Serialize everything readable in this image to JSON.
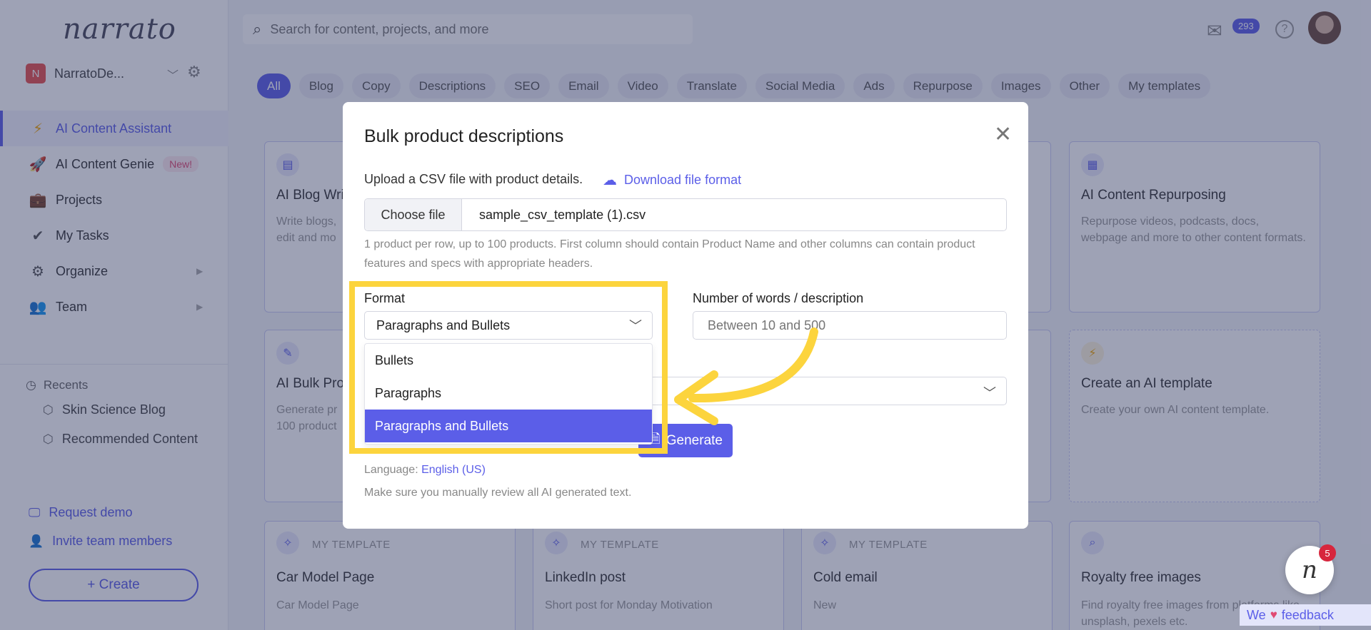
{
  "app": {
    "logo": "narrato"
  },
  "org": {
    "badge": "N",
    "name": "NarratoDe..."
  },
  "nav": {
    "items": [
      {
        "label": "AI Content Assistant",
        "icon": "⚡"
      },
      {
        "label": "AI Content Genie",
        "icon": "🚀",
        "badge": "New!"
      },
      {
        "label": "Projects",
        "icon": "💼"
      },
      {
        "label": "My Tasks",
        "icon": "✔"
      },
      {
        "label": "Organize",
        "icon": "⚙"
      },
      {
        "label": "Team",
        "icon": "👥"
      }
    ]
  },
  "recents": {
    "title": "Recents",
    "items": [
      "Skin Science Blog",
      "Recommended Content"
    ]
  },
  "bottom_links": {
    "request_demo": "Request demo",
    "invite": "Invite team members"
  },
  "create_button": "+ Create",
  "header": {
    "search_placeholder": "Search for content, projects, and more",
    "mail_count": "293",
    "help": "?"
  },
  "filters": [
    "All",
    "Blog",
    "Copy",
    "Descriptions",
    "SEO",
    "Email",
    "Video",
    "Translate",
    "Social Media",
    "Ads",
    "Repurpose",
    "Images",
    "Other",
    "My templates"
  ],
  "cards": {
    "blog_title": "AI Blog Writ",
    "blog_desc": "Write blogs, edit and mo",
    "repurpose_title": "AI Content Repurposing",
    "repurpose_desc": "Repurpose videos, podcasts, docs, webpage and more to other content formats.",
    "bulk_title": "AI Bulk Pro",
    "bulk_desc": "Generate pr 100 product",
    "template_title": "Create an AI template",
    "template_desc": "Create your own AI content template.",
    "tpl_tag": "MY TEMPLATE",
    "car_title": "Car Model Page",
    "car_desc": "Car Model Page",
    "linkedin_title": "LinkedIn post",
    "linkedin_desc": "Short post for Monday Motivation",
    "cold_title": "Cold email",
    "cold_desc": "New",
    "royalty_title": "Royalty free images",
    "royalty_desc": "Find royalty free images from platforms like unsplash, pexels etc."
  },
  "modal": {
    "title": "Bulk product descriptions",
    "upload_label": "Upload a CSV file with product details.",
    "download_link": "Download file format",
    "choose_file": "Choose file",
    "file_name": "sample_csv_template (1).csv",
    "help_text": "1 product per row, up to 100 products. First column should contain Product Name and other columns can contain product features and specs with appropriate headers.",
    "format_label": "Format",
    "format_value": "Paragraphs and Bullets",
    "format_options": [
      "Bullets",
      "Paragraphs",
      "Paragraphs and Bullets"
    ],
    "words_label": "Number of words / description",
    "words_placeholder": "Between 10 and 500",
    "generate": "Generate",
    "language_label": "Language:",
    "language_value": "English (US)",
    "review_note": "Make sure you manually review all AI generated text."
  },
  "chat": {
    "logo": "n",
    "count": "5"
  },
  "feedback": {
    "we": "We",
    "label": "feedback"
  },
  "colors": {
    "accent": "#5b5ee8",
    "highlight": "#fcd43d",
    "badge_red": "#d7263d"
  }
}
